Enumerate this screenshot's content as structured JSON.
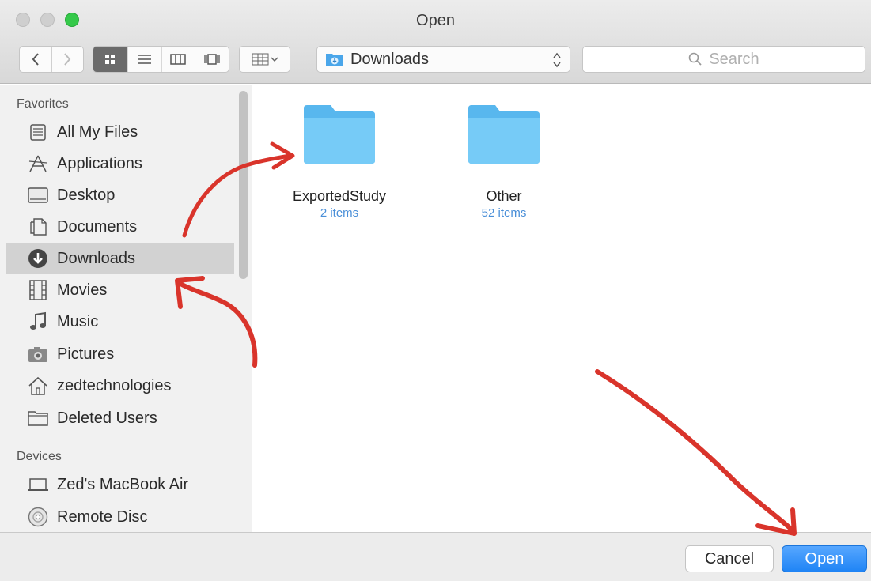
{
  "window": {
    "title": "Open"
  },
  "toolbar": {
    "back_icon": "chevron-left-icon",
    "forward_icon": "chevron-right-icon",
    "views": [
      "icon-view-icon",
      "list-view-icon",
      "column-view-icon",
      "coverflow-view-icon"
    ],
    "arrange_icon": "arrange-grid-icon",
    "location": "Downloads",
    "search_placeholder": "Search"
  },
  "sidebar": {
    "favorites_heading": "Favorites",
    "favorites": [
      {
        "label": "All My Files",
        "icon": "all-files-icon"
      },
      {
        "label": "Applications",
        "icon": "applications-icon"
      },
      {
        "label": "Desktop",
        "icon": "desktop-icon"
      },
      {
        "label": "Documents",
        "icon": "documents-icon"
      },
      {
        "label": "Downloads",
        "icon": "downloads-icon",
        "selected": true
      },
      {
        "label": "Movies",
        "icon": "movies-icon"
      },
      {
        "label": "Music",
        "icon": "music-icon"
      },
      {
        "label": "Pictures",
        "icon": "pictures-icon"
      },
      {
        "label": "zedtechnologies",
        "icon": "home-icon"
      },
      {
        "label": "Deleted Users",
        "icon": "folder-icon"
      }
    ],
    "devices_heading": "Devices",
    "devices": [
      {
        "label": "Zed's MacBook Air",
        "icon": "laptop-icon"
      },
      {
        "label": "Remote Disc",
        "icon": "disc-icon"
      }
    ]
  },
  "content": {
    "items": [
      {
        "name": "ExportedStudy",
        "count": "2 items"
      },
      {
        "name": "Other",
        "count": "52 items"
      }
    ]
  },
  "footer": {
    "cancel_label": "Cancel",
    "open_label": "Open"
  },
  "colors": {
    "accent": "#1f84f5",
    "folder": "#6ec4f5",
    "annotation": "#d9342b",
    "item_count": "#4a8fd8"
  }
}
